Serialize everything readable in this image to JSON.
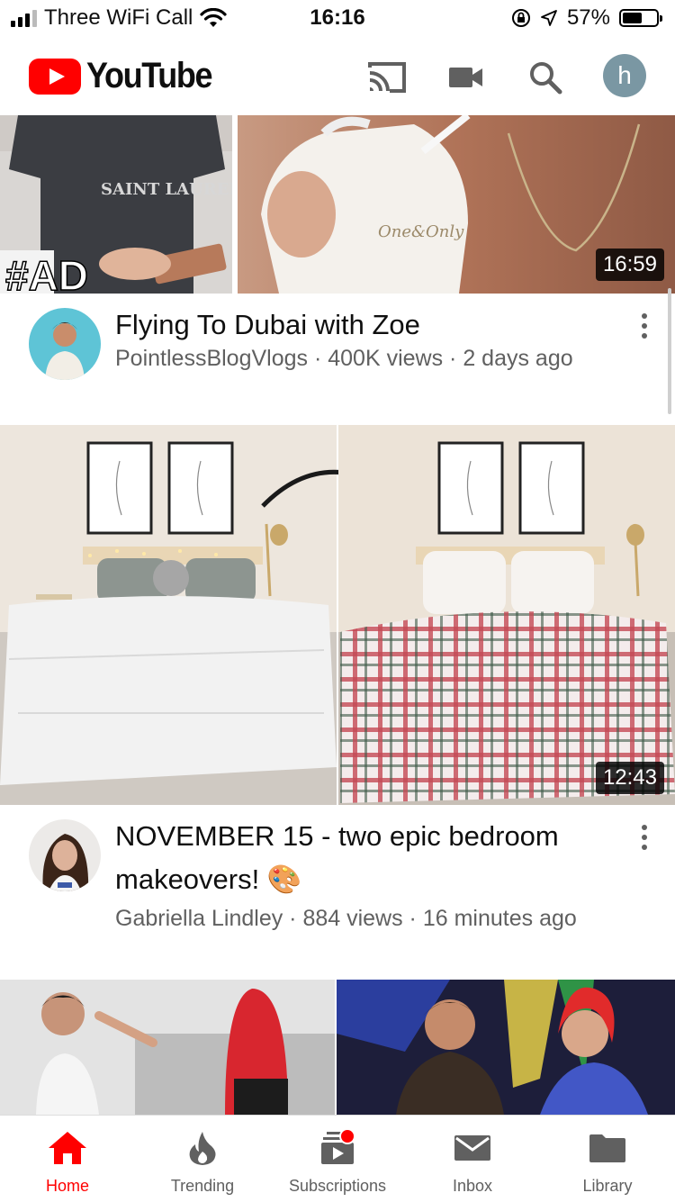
{
  "status_bar": {
    "carrier": "Three WiFi Call",
    "time": "16:16",
    "battery": "57%",
    "battery_level": 0.57
  },
  "header": {
    "logo_text": "YouTube",
    "avatar_initial": "h",
    "icons": [
      "cast-icon",
      "camera-icon",
      "search-icon"
    ]
  },
  "videos": [
    {
      "title": "Flying To Dubai with Zoe",
      "channel": "PointlessBlogVlogs",
      "views": "400K views",
      "age": "2 days ago",
      "duration": "16:59",
      "thumb_text": {
        "shirt": "SAINT LAURENT",
        "tag": "#AD",
        "bottle": "One&Only"
      }
    },
    {
      "title": "NOVEMBER 15 - two epic bedroom makeovers! 🎨",
      "channel": "Gabriella Lindley",
      "views": "884 views",
      "age": "16 minutes ago",
      "duration": "12:43"
    }
  ],
  "meta_separator": " · ",
  "bottom_nav": [
    {
      "label": "Home",
      "icon": "home-icon",
      "active": true
    },
    {
      "label": "Trending",
      "icon": "flame-icon",
      "active": false
    },
    {
      "label": "Subscriptions",
      "icon": "subscriptions-icon",
      "active": false,
      "badge": true
    },
    {
      "label": "Inbox",
      "icon": "mail-icon",
      "active": false
    },
    {
      "label": "Library",
      "icon": "folder-icon",
      "active": false
    }
  ],
  "colors": {
    "brand_red": "#ff0000",
    "secondary_text": "#606060",
    "avatar_bg": "#7a97a3"
  }
}
